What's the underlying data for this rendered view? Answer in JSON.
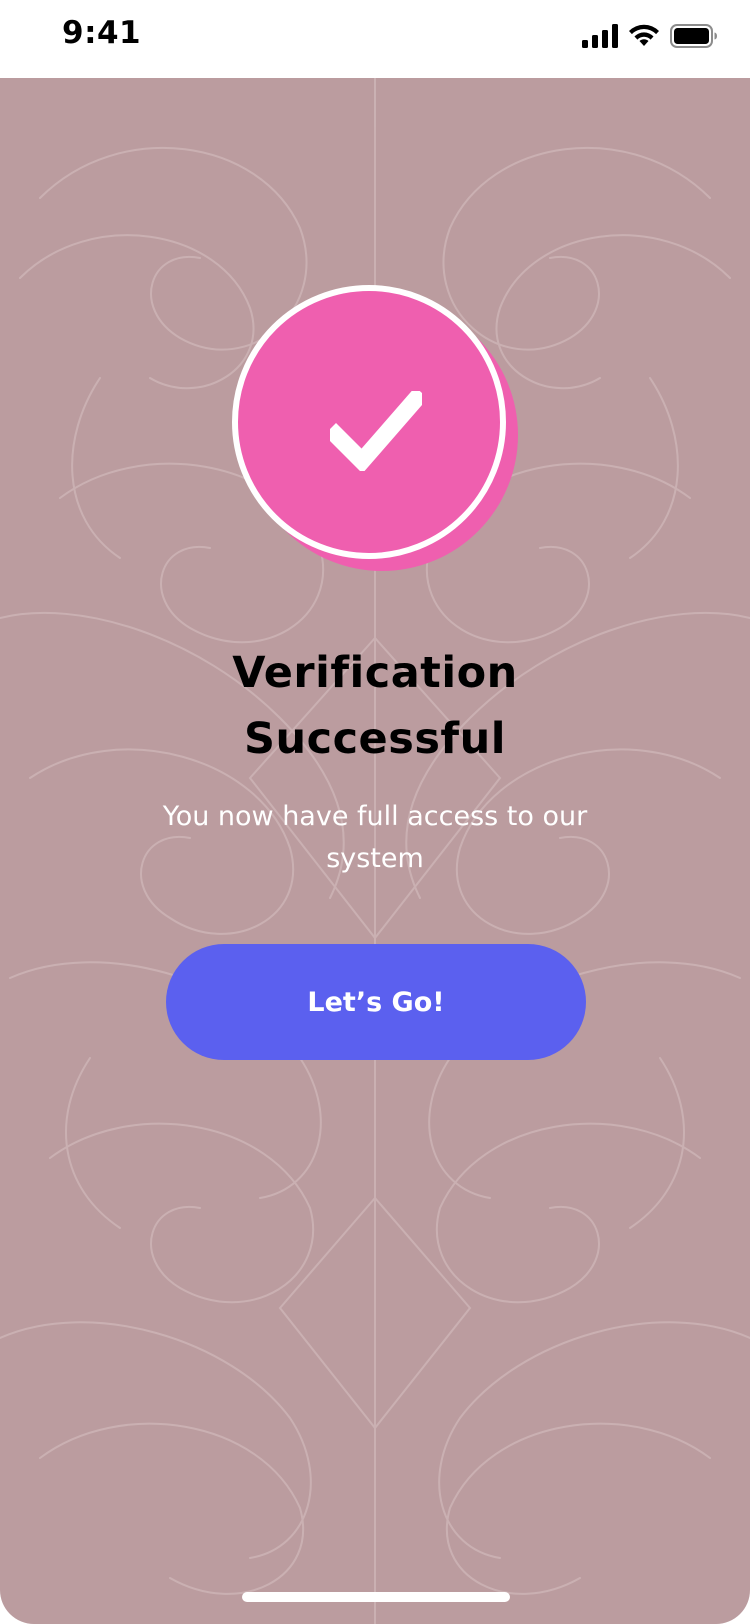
{
  "status_bar": {
    "time": "9:41",
    "icons": [
      "cellular-signal-icon",
      "wifi-icon",
      "battery-icon"
    ]
  },
  "badge": {
    "icon": "checkmark-icon",
    "color": "#ef5faf"
  },
  "content": {
    "title_line1": "Verification",
    "title_line2": "Successful",
    "subtitle": "You now have full access to our system"
  },
  "button": {
    "label": "Let’s Go!",
    "color": "#5b60ef"
  },
  "colors": {
    "background": "#bb9c9f",
    "text_primary": "#000000",
    "text_secondary": "#ffffff"
  }
}
